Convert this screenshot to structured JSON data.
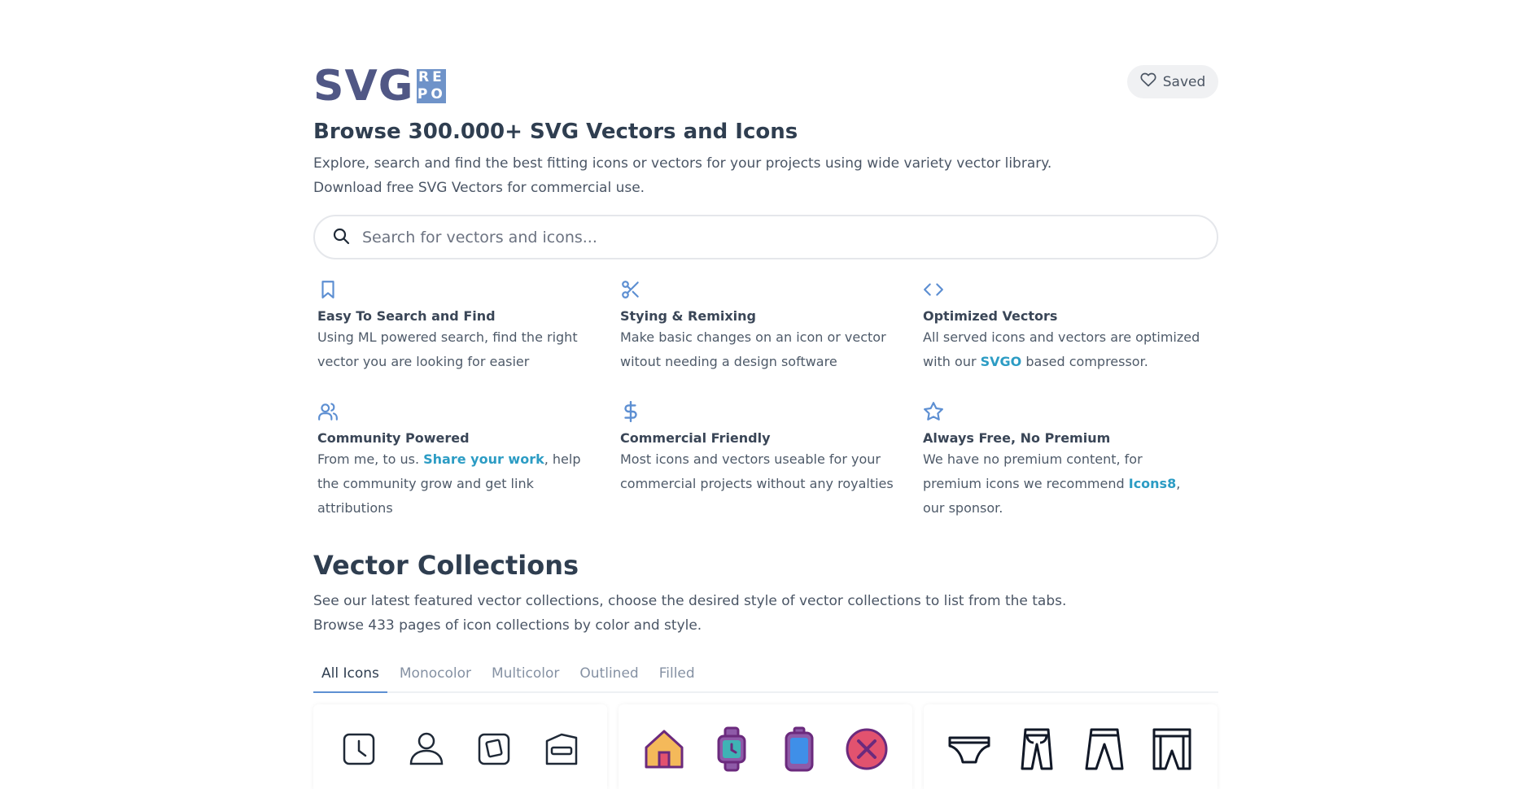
{
  "logo": {
    "main": "SVG",
    "badge": [
      "RE",
      "PO"
    ]
  },
  "header": {
    "saved_label": "Saved"
  },
  "hero": {
    "title": "Browse 300.000+ SVG Vectors and Icons",
    "lines": [
      "Explore, search and find the best fitting icons or vectors for your projects using wide variety vector library.",
      "Download free SVG Vectors for commercial use."
    ]
  },
  "search": {
    "placeholder": "Search for vectors and icons..."
  },
  "features": [
    {
      "icon": "bookmark-icon",
      "title": "Easy To Search and Find",
      "text": "Using ML powered search, find the right vector you are looking for easier"
    },
    {
      "icon": "scissors-icon",
      "title": "Stying & Remixing",
      "text": "Make basic changes on an icon or vector witout needing a design software"
    },
    {
      "icon": "code-icon",
      "title": "Optimized Vectors",
      "text_before": "All served icons and vectors are optimized with our ",
      "link": "SVGO",
      "text_after": " based compressor."
    },
    {
      "icon": "users-icon",
      "title": "Community Powered",
      "text_before": "From me, to us. ",
      "link": "Share your work",
      "text_after": ", help the community grow and get link attributions"
    },
    {
      "icon": "dollar-icon",
      "title": "Commercial Friendly",
      "text": "Most icons and vectors useable for your commercial projects without any royalties"
    },
    {
      "icon": "star-icon",
      "title": "Always Free, No Premium",
      "text_before": "We have no premium content, for premium icons we recommend ",
      "link": "Icons8",
      "text_after": ", our sponsor."
    }
  ],
  "collections": {
    "title": "Vector Collections",
    "lines": [
      "See our latest featured vector collections, choose the desired style of vector collections to list from the tabs.",
      "Browse 433 pages of icon collections by color and style."
    ],
    "tabs": [
      "All Icons",
      "Monocolor",
      "Multicolor",
      "Outlined",
      "Filled"
    ],
    "active_tab": "All Icons"
  },
  "cards": [
    {
      "icons": [
        "clock-square-icon",
        "user-icon",
        "rotate-square-icon",
        "folder-minus-icon"
      ]
    },
    {
      "icons": [
        "home-icon",
        "smartwatch-icon",
        "phone-icon",
        "close-circle-icon"
      ]
    },
    {
      "icons": [
        "underwear-icon",
        "trousers-icon",
        "pants-icon",
        "shorts-icon"
      ]
    }
  ],
  "colors": {
    "accent": "#5d8fd2",
    "link": "#2c9cc4",
    "logo": "#505785",
    "logo_badge": "#6f93c9"
  }
}
